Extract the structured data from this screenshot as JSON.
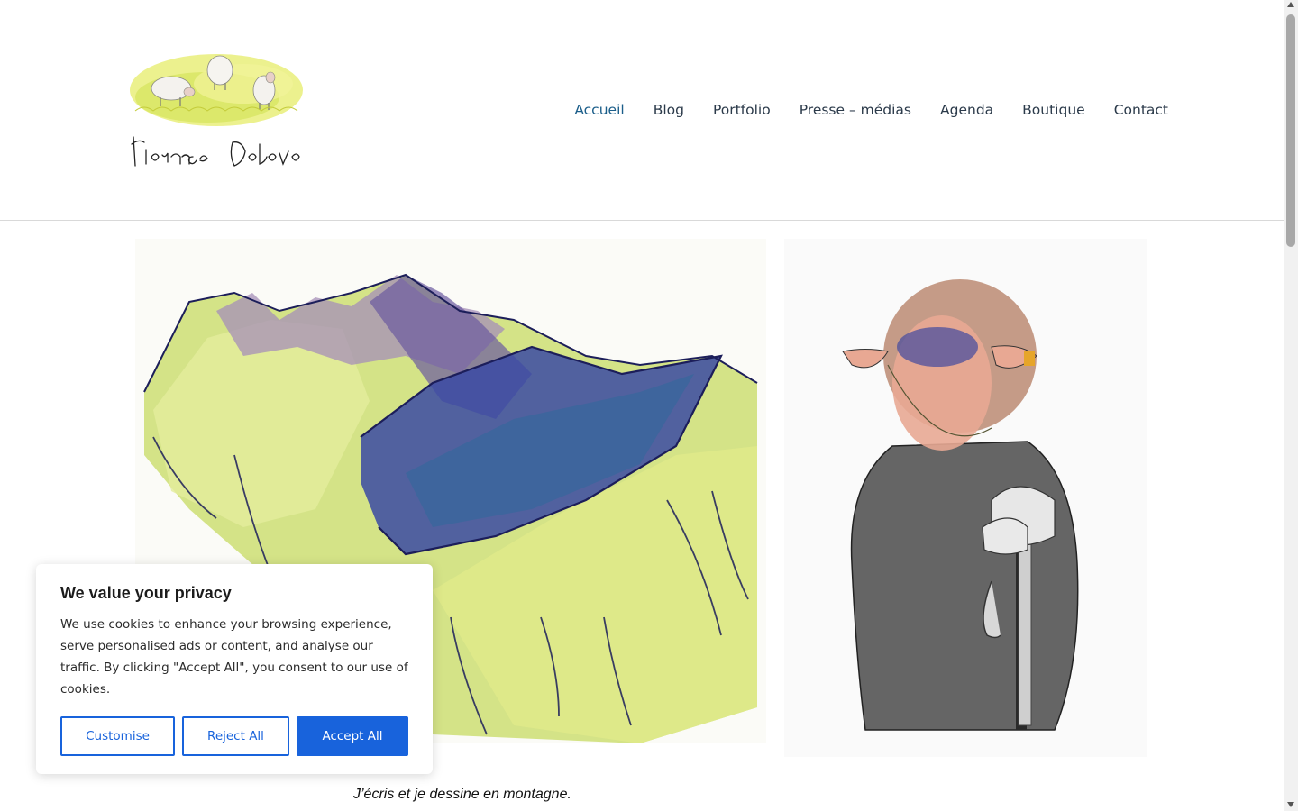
{
  "logo": {
    "signature": "Florence Debove"
  },
  "nav": {
    "items": [
      {
        "label": "Accueil",
        "active": true
      },
      {
        "label": "Blog"
      },
      {
        "label": "Portfolio"
      },
      {
        "label": "Presse – médias"
      },
      {
        "label": "Agenda"
      },
      {
        "label": "Boutique"
      },
      {
        "label": "Contact"
      }
    ]
  },
  "main": {
    "caption": "J’écris et je dessine en montagne."
  },
  "cookie_banner": {
    "title": "We value your privacy",
    "text": "We use cookies to enhance your browsing experience, serve personalised ads or content, and analyse our traffic. By clicking \"Accept All\", you consent to our use of cookies.",
    "customise_label": "Customise",
    "reject_label": "Reject All",
    "accept_label": "Accept All"
  },
  "colors": {
    "accent": "#1863dc",
    "nav_active": "#1b5e8a",
    "nav_text": "#2b3a4a"
  }
}
